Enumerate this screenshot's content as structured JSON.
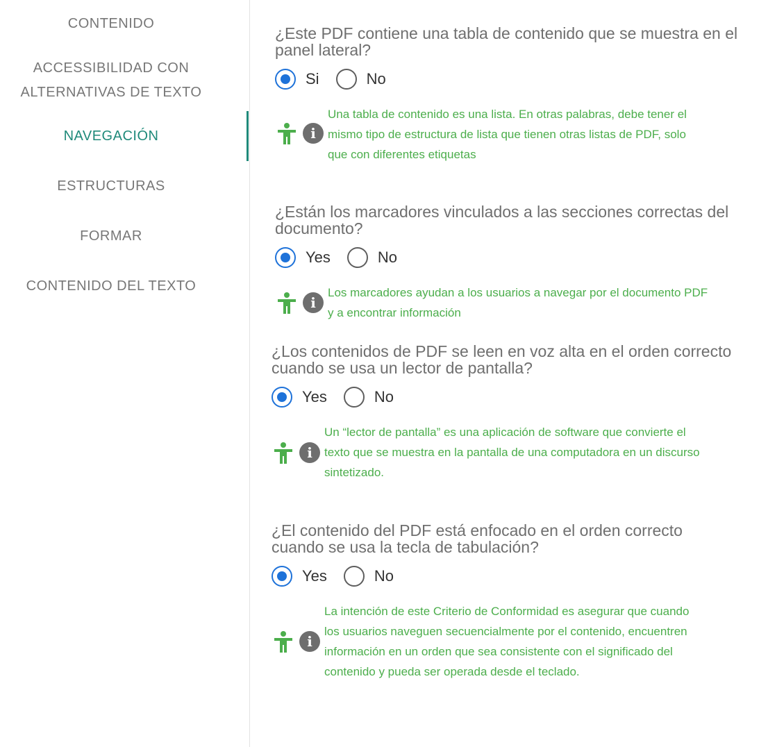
{
  "sidebar": {
    "items": [
      {
        "label": "CONTENIDO"
      },
      {
        "label": "ACCESSIBILIDAD CON"
      },
      {
        "label": "ALTERNATIVAS DE TEXTO"
      },
      {
        "label": "NAVEGACIÓN"
      },
      {
        "label": "ESTRUCTURAS"
      },
      {
        "label": "FORMAR"
      },
      {
        "label": "CONTENIDO DEL TEXTO"
      }
    ],
    "active_color": "#1f8a7a"
  },
  "questions": [
    {
      "title_line1": "¿Este PDF contiene una tabla de contenido que se muestra en el",
      "title_line2": "panel lateral?",
      "options": [
        "Si",
        "No"
      ],
      "selected": "Si",
      "tip_lines": [
        "Una tabla de contenido es una lista. En otras palabras, debe tener el",
        "mismo tipo de estructura de lista que tienen otras listas de PDF, solo",
        "que con diferentes etiquetas"
      ]
    },
    {
      "title_line1": "¿Están los marcadores vinculados a las secciones correctas del",
      "title_line2": "documento?",
      "options": [
        "Yes",
        "No"
      ],
      "selected": "Yes",
      "tip_lines": [
        "Los marcadores ayudan a los usuarios a navegar por el documento PDF",
        "y a encontrar información"
      ]
    },
    {
      "title_line1": "¿Los contenidos de PDF se leen en voz alta en el orden correcto",
      "title_line2": "cuando se usa un lector de pantalla?",
      "options": [
        "Yes",
        "No"
      ],
      "selected": "Yes",
      "tip_lines": [
        "Un “lector de pantalla” es una aplicación de software que convierte el",
        "texto que se muestra en la pantalla de una computadora en un discurso",
        "sintetizado."
      ]
    },
    {
      "title_line1": "¿El contenido del PDF está enfocado en el orden correcto",
      "title_line2": "cuando se usa la tecla de tabulación?",
      "options": [
        "Yes",
        "No"
      ],
      "selected": "Yes",
      "tip_lines": [
        "La intención de este Criterio de Conformidad es asegurar que cuando",
        "los usuarios naveguen secuencialmente por el contenido, encuentren",
        "información en un orden que sea consistente con el significado del",
        "contenido y pueda ser operada desde el teclado."
      ]
    }
  ],
  "icons": {
    "accessibility": "accessibility-person-icon",
    "info": "info-icon",
    "info_glyph": "i"
  },
  "colors": {
    "tip_text": "#4cae4c",
    "radio_selected": "#1e72d9",
    "accessibility_icon": "#4cae4c",
    "info_icon_bg": "#6e6e6e"
  }
}
